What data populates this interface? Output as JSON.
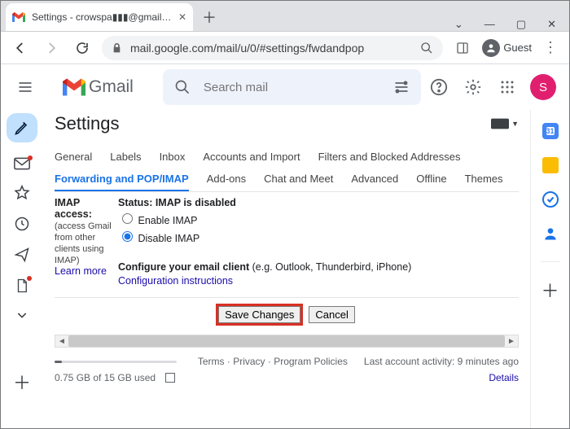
{
  "browser": {
    "tab_title": "Settings - crowspa▮▮▮@gmail…",
    "url": "mail.google.com/mail/u/0/#settings/fwdandpop",
    "guest_label": "Guest"
  },
  "header": {
    "product": "Gmail",
    "search_placeholder": "Search mail",
    "avatar_letter": "S"
  },
  "page": {
    "title": "Settings",
    "tabs_row1": [
      "General",
      "Labels",
      "Inbox",
      "Accounts and Import",
      "Filters and Blocked Addresses"
    ],
    "tabs_row2": [
      "Forwarding and POP/IMAP",
      "Add-ons",
      "Chat and Meet",
      "Advanced",
      "Offline",
      "Themes"
    ],
    "active_tab": "Forwarding and POP/IMAP"
  },
  "imap": {
    "section_label_1": "IMAP access:",
    "section_note_1": "(access Gmail from other clients using IMAP)",
    "learn_more": "Learn more",
    "status_label": "Status: IMAP is disabled",
    "option_enable": "Enable IMAP",
    "option_disable": "Disable IMAP",
    "selected": "disable",
    "config_line_bold": "Configure your email client",
    "config_line_rest": " (e.g. Outlook, Thunderbird, iPhone)",
    "config_link": "Configuration instructions"
  },
  "buttons": {
    "save": "Save Changes",
    "cancel": "Cancel"
  },
  "footer": {
    "storage_text": "0.75 GB of 15 GB used",
    "policies": "Terms · Privacy · Program Policies",
    "activity": "Last account activity: 9 minutes ago",
    "details": "Details"
  }
}
